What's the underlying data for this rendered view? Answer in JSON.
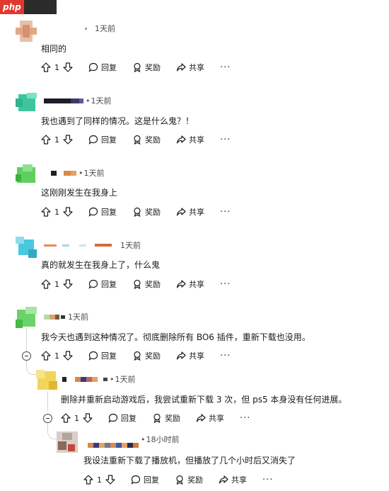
{
  "site_badge": "php",
  "comments": [
    {
      "time": "1天前",
      "text": "相同的",
      "votes": "1"
    },
    {
      "time": "1天前",
      "text": "我也遇到了同样的情况。这是什么鬼？！",
      "votes": "1"
    },
    {
      "time": "1天前",
      "text": "这刚刚发生在我身上",
      "votes": "1"
    },
    {
      "time": "1天前",
      "text": "真的就发生在我身上了，什么鬼",
      "votes": "1"
    },
    {
      "time": "1天前",
      "text": "我今天也遇到这种情况了。彻底删除所有 BO6 插件，重新下载也没用。",
      "votes": "1"
    },
    {
      "time": "1天前",
      "text": "删除并重新启动游戏后，我尝试重新下载 3 次，但 ps5 本身没有任何进展。",
      "votes": "1"
    },
    {
      "time": "18小时前",
      "text": "我设法重新下载了播放机，但播放了几个小时后又消失了",
      "votes": "1"
    }
  ],
  "actions": {
    "reply": "回复",
    "award": "奖励",
    "share": "共享",
    "more": "···"
  },
  "colors": {
    "text": "#1a1a1b",
    "muted": "#4a4a4a",
    "thread_line": "#d4d4d4"
  }
}
